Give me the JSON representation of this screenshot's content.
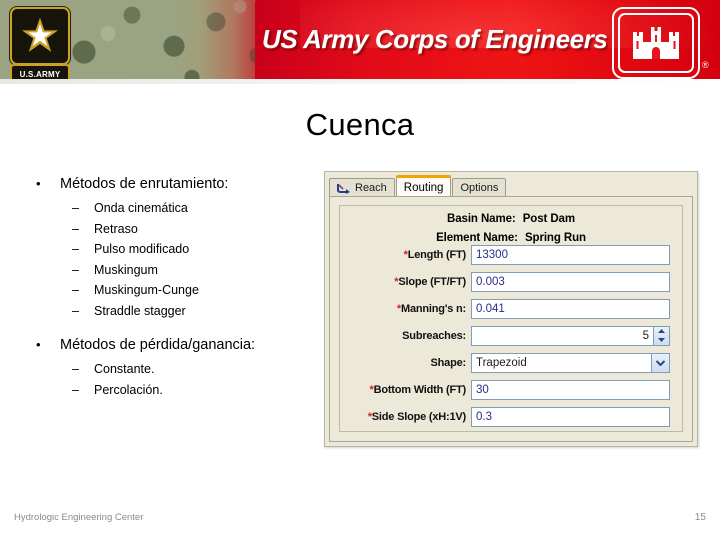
{
  "header": {
    "wordmark": "US Army Corps of Engineers",
    "army_band_label": "U.S.ARMY",
    "registered_mark": "®",
    "colors": {
      "red": "#d4000f",
      "camo_green": "#9aa483",
      "gold": "#c9a227"
    }
  },
  "slide": {
    "title": "Cuenca",
    "bullets": [
      {
        "label": "Métodos de enrutamiento:",
        "marker": "•",
        "sub_marker": "–",
        "sub_items": [
          "Onda cinemática",
          "Retraso",
          "Pulso modificado",
          "Muskingum",
          "Muskingum-Cunge",
          "Straddle stagger"
        ]
      },
      {
        "label": "Métodos de pérdida/ganancia:",
        "marker": "•",
        "sub_marker": "–",
        "sub_items": [
          "Constante.",
          "Percolación."
        ]
      }
    ]
  },
  "dialog": {
    "tabs": [
      {
        "label": "Reach",
        "icon": "reach-channel-icon",
        "active": false
      },
      {
        "label": "Routing",
        "icon": null,
        "active": true
      },
      {
        "label": "Options",
        "icon": null,
        "active": false
      }
    ],
    "active_tab_accent": "#f0a500",
    "headers": [
      {
        "label": "Basin Name:",
        "value": "Post Dam"
      },
      {
        "label": "Element Name:",
        "value": "Spring Run"
      }
    ],
    "fields": [
      {
        "label": "*Length (FT)",
        "required": true,
        "value": "13300",
        "type": "text"
      },
      {
        "label": "*Slope (FT/FT)",
        "required": true,
        "value": "0.003",
        "type": "text"
      },
      {
        "label": "*Manning's n:",
        "required": true,
        "value": "0.041",
        "type": "text"
      },
      {
        "label": "Subreaches:",
        "required": false,
        "value": "5",
        "type": "spinner"
      },
      {
        "label": "Shape:",
        "required": false,
        "value": "Trapezoid",
        "type": "select"
      },
      {
        "label": "*Bottom Width (FT)",
        "required": true,
        "value": "30",
        "type": "text"
      },
      {
        "label": "*Side Slope (xH:1V)",
        "required": true,
        "value": "0.3",
        "type": "text"
      }
    ]
  },
  "footer": {
    "organization": "Hydrologic Engineering Center",
    "page_number": "15"
  }
}
